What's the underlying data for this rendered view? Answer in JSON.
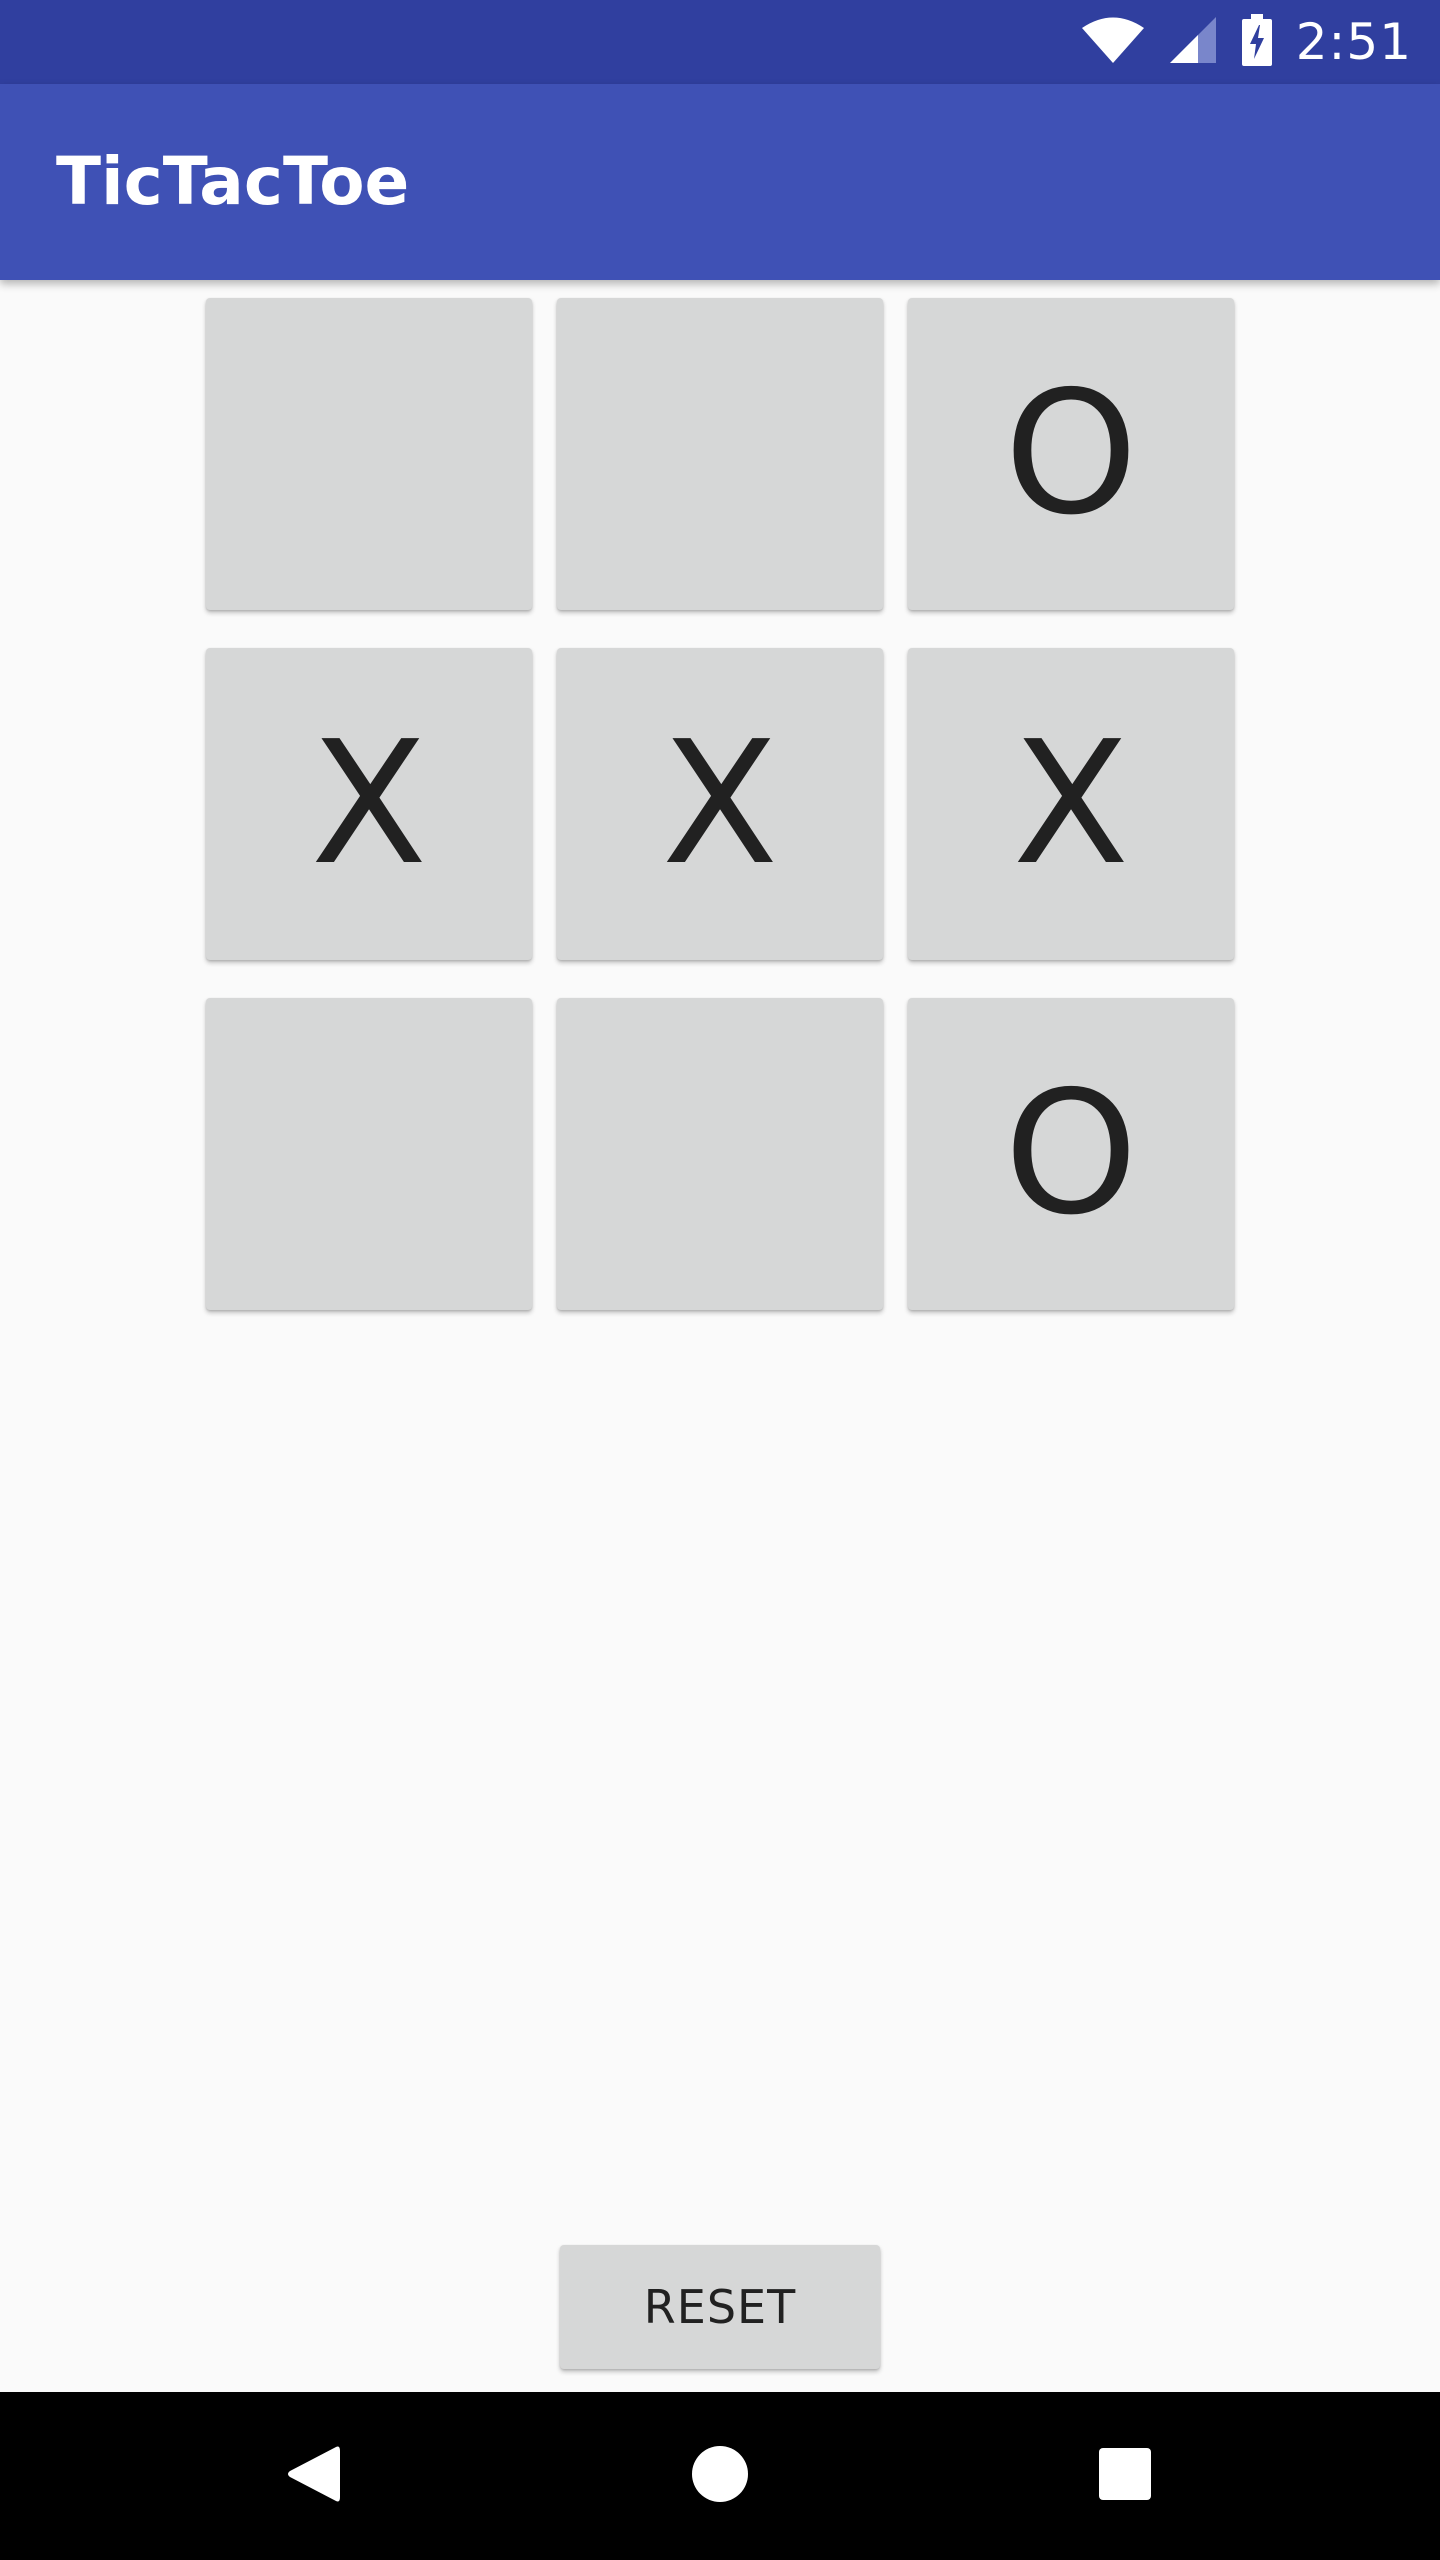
{
  "status_bar": {
    "time": "2:51",
    "icons": [
      "wifi-icon",
      "cell-signal-icon",
      "battery-charging-icon"
    ],
    "background": "#303F9F"
  },
  "app_bar": {
    "title": "TicTacToe",
    "background": "#3F51B5"
  },
  "board": {
    "cells": [
      [
        "",
        "",
        "O"
      ],
      [
        "X",
        "X",
        "X"
      ],
      [
        "",
        "",
        "O"
      ]
    ],
    "cell_color": "#D6D7D7",
    "mark_color": "#212121"
  },
  "reset_button": {
    "label": "RESET"
  },
  "nav_bar": {
    "buttons": [
      "back-icon",
      "home-icon",
      "recents-icon"
    ],
    "background": "#000000"
  }
}
